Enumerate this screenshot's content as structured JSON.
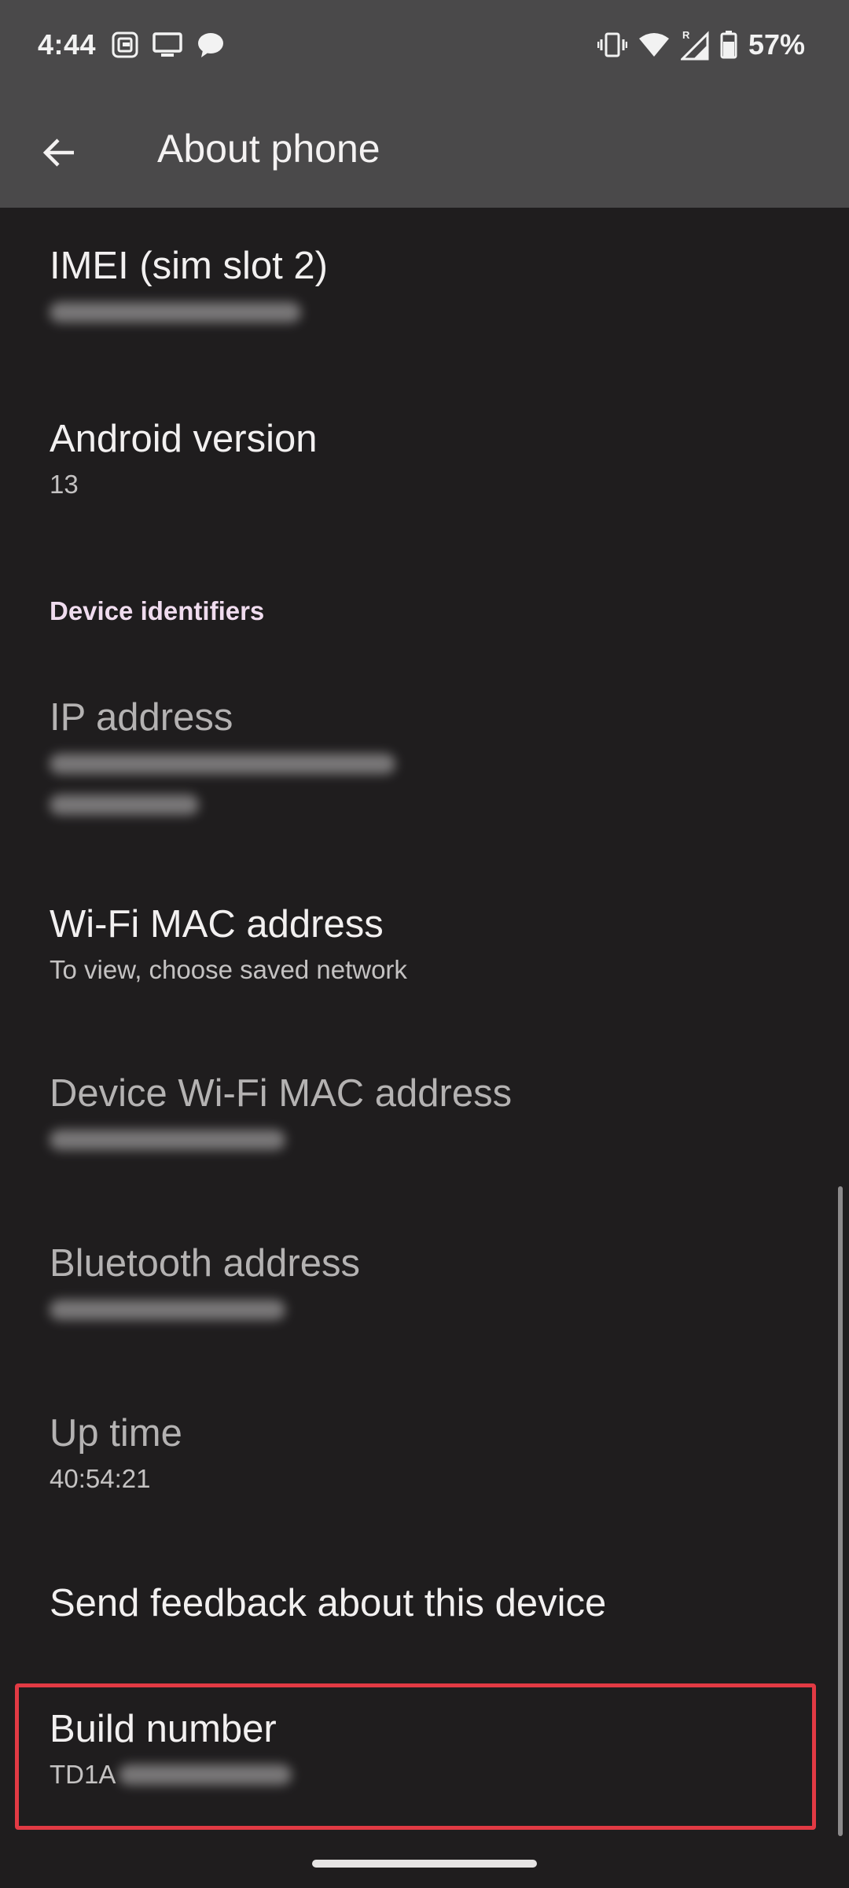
{
  "status_bar": {
    "time": "4:44",
    "battery": "57%",
    "icons_left": [
      "app-notification-icon",
      "cast-screen-icon",
      "chat-bubble-icon"
    ],
    "icons_right": [
      "vibrate-icon",
      "wifi-icon",
      "signal-roaming-icon",
      "battery-icon"
    ]
  },
  "app_bar": {
    "title": "About phone",
    "back_icon": "arrow-back-icon"
  },
  "items": [
    {
      "id": "imei-sim-2",
      "title": "IMEI (sim slot 2)",
      "subtitle": null,
      "redacted": true
    },
    {
      "id": "android-version",
      "title": "Android version",
      "subtitle": "13"
    },
    {
      "id": "ip-address",
      "title": "IP address",
      "redacted": true
    },
    {
      "id": "wifi-mac",
      "title": "Wi-Fi MAC address",
      "subtitle": "To view, choose saved network"
    },
    {
      "id": "device-wifi-mac",
      "title": "Device Wi-Fi MAC address",
      "redacted": true
    },
    {
      "id": "bluetooth-address",
      "title": "Bluetooth address",
      "redacted": true
    },
    {
      "id": "up-time",
      "title": "Up time",
      "subtitle": "40:54:21"
    },
    {
      "id": "send-feedback",
      "title": "Send feedback about this device"
    },
    {
      "id": "build-number",
      "title": "Build number",
      "subtitle_prefix": "TD1A",
      "redacted": true
    }
  ],
  "section_header": "Device identifiers",
  "colors": {
    "header_bg": "#4a494a",
    "screen_bg": "#1f1d1e",
    "section_header": "#f0dcef",
    "highlight": "#e23a44"
  }
}
